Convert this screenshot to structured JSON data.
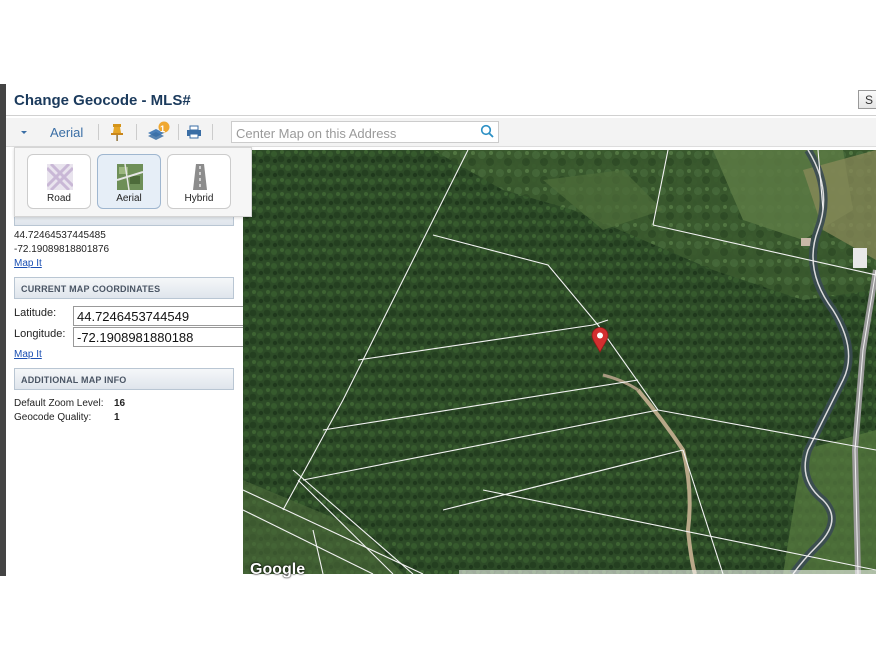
{
  "dialog": {
    "title": "Change Geocode - MLS#",
    "corner_button_label": "S"
  },
  "toolbar": {
    "map_type_label": "Aerial",
    "layers_badge": "1",
    "search_placeholder": "Center Map on this Address",
    "icons": [
      "chevron-down-icon",
      "pushpin-icon",
      "layers-icon",
      "print-icon",
      "search-icon"
    ]
  },
  "map_types": [
    {
      "label": "Road",
      "active": false
    },
    {
      "label": "Aerial",
      "active": true
    },
    {
      "label": "Hybrid",
      "active": false
    }
  ],
  "original": {
    "latitude": "44.72464537445485",
    "longitude": "-72.19089818801876",
    "map_it": "Map It"
  },
  "current": {
    "heading": "CURRENT MAP COORDINATES",
    "latitude_label": "Latitude:",
    "latitude_value": "44.7246453744549",
    "longitude_label": "Longitude:",
    "longitude_value": "-72.1908981880188",
    "map_it": "Map It"
  },
  "additional": {
    "heading": "ADDITIONAL MAP INFO",
    "zoom_label": "Default Zoom Level:",
    "zoom_value": "16",
    "quality_label": "Geocode Quality:",
    "quality_value": "1"
  },
  "map": {
    "logo": "Google",
    "marker_color": "#d32f2f"
  },
  "colors": {
    "title": "#1b3a5c",
    "link": "#1a4fb3",
    "accent": "#3a6ea5"
  }
}
